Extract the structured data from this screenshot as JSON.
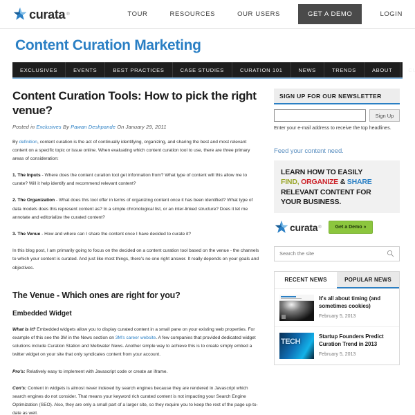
{
  "header": {
    "brand": "curata",
    "brand_tm": "®",
    "nav": [
      {
        "label": "TOUR",
        "style": "plain"
      },
      {
        "label": "RESOURCES",
        "style": "plain"
      },
      {
        "label": "OUR USERS",
        "style": "plain"
      },
      {
        "label": "GET A DEMO",
        "style": "demo"
      },
      {
        "label": "LOGIN",
        "style": "plain"
      }
    ]
  },
  "site": {
    "title": "Content Curation Marketing",
    "nav": [
      "EXCLUSIVES",
      "EVENTS",
      "BEST PRACTICES",
      "CASE STUDIES",
      "CURATION 101",
      "NEWS",
      "TRENDS",
      "ABOUT",
      "CURATA"
    ]
  },
  "article": {
    "title": "Content Curation Tools: How to pick the right venue?",
    "meta_posted_in": "Posted in",
    "meta_category": "Exclusives",
    "meta_by": "By",
    "meta_author": "Pawan Deshpande",
    "meta_on": "On",
    "meta_date": "January 29, 2011",
    "p_intro_1": "By",
    "p_intro_link": "definition",
    "p_intro_2": ", content curation is the act of continually identifying, organizing, and sharing the best and most relevant content on a specific topic or issue online.  When evaluating which content curation tool to use, there are three primary areas of consideration:",
    "p1_head": "1. The Inputs",
    "p1_body": " - Where does the content curation tool get information from? What type of content will this allow me to curate? Will it help identify and recommend relevant content?",
    "p2_head": "2. The Organization",
    "p2_body": " - What does this tool offer in terms of organizing content once it has been identified?  What type of data models does this represent content as? In a simple chronological list, or an inter-linked structure? Does it let me annotate and editorialize the curated content?",
    "p3_head": "3. The Venue",
    "p3_body": " - How and where can I share the content once I have decided to curate it?",
    "p4": "In this blog post, I am primarily going to focus on the decided on a content curation tool based on the venue - the channels to which your content is curated.  And just like most things, there's no one right answer.  It really depends on your goals and objectives.",
    "section_heading": "The Venue - Which ones are right for you?",
    "sub_heading": "Embedded Widget",
    "widget_q": "What is it?",
    "widget_a1": " Embedded widgets allow you to display curated content in a small pane on your existing web properties.  For example of this see the 3M in the News section on ",
    "widget_link": "3M's career website",
    "widget_a2": ". A few companies that provided dedicated widget solutions include Curation Station and Meltwater News. Another simple way to achieve this is to create simply embed a twitter widget on your site that only syndicates content from your account.",
    "pros_label": "Pro's:",
    "pros_body": " Relatively easy to implement with Javascript code or create an iframe.",
    "cons_label": "Con's:",
    "cons_body": " Content in widgets is almost never indexed by search engines because they are rendered in Javascript which search engines do not consider.  That means your keyword rich curated content is not impacting your Search Engine Optimization (SEO). Also, they are only a small part of a larger site, so they require you to keep the rest of the page up-to-date as well."
  },
  "sidebar": {
    "newsletter": {
      "heading": "SIGN UP FOR OUR NEWSLETTER",
      "input_value": "",
      "input_placeholder": "",
      "button": "Sign Up",
      "note": "Enter your e-mail address to receive the top headlines."
    },
    "feed_line": "Feed your content need.",
    "ad": {
      "line1": "LEARN HOW TO EASILY",
      "find": "FIND,",
      "organize": "ORGANIZE",
      "amp": "&",
      "share": "SHARE",
      "line3": "RELEVANT CONTENT FOR",
      "line4": "YOUR BUSINESS.",
      "brand": "curata",
      "brand_tm": "®",
      "cta": "Get a Demo »",
      "cta_color": "#8cc63e",
      "find_color": "#9aa62a",
      "organize_color": "#cc2027",
      "share_color": "#2a7fc4"
    },
    "search": {
      "value": "",
      "placeholder": "Search the site",
      "icon": "search-icon"
    },
    "news": {
      "tab_recent": "RECENT NEWS",
      "tab_popular": "POPULAR NEWS",
      "items": [
        {
          "title": "It's all about timing (and sometimes cookies)",
          "date": "February 5, 2013",
          "thumb": "screenshot-thumbnail"
        },
        {
          "title": "Startup Founders Predict Curation Trend in 2013",
          "date": "February 5, 2013",
          "thumb": "tech-trends-thumbnail",
          "thumb_word": "TECH"
        }
      ]
    }
  },
  "colors": {
    "brand_blue": "#2a7fc4",
    "nav_dark": "#1e1e1e",
    "demo_button": "#4a4a4a"
  }
}
